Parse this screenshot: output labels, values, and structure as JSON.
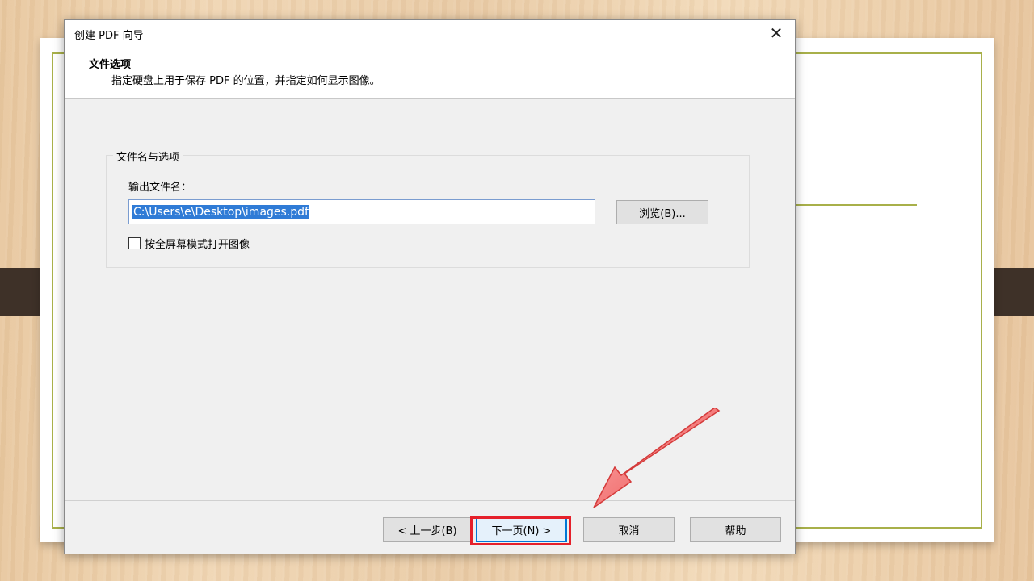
{
  "window": {
    "title": "创建 PDF 向导",
    "close_glyph": "✕"
  },
  "header": {
    "title": "文件选项",
    "subtitle": "指定硬盘上用于保存 PDF 的位置，并指定如何显示图像。"
  },
  "file_group": {
    "legend": "文件名与选项",
    "output_label": "输出文件名：",
    "output_path": "C:\\Users\\e\\Desktop\\images.pdf",
    "browse_label": "浏览(B)...",
    "fullscreen_label": "按全屏幕模式打开图像",
    "fullscreen_checked": false
  },
  "buttons": {
    "back": "< 上一步(B)",
    "next": "下一页(N) >",
    "cancel": "取消",
    "help": "帮助"
  },
  "colors": {
    "highlight": "#e5202a",
    "arrow": "#f06a6a",
    "selection": "#2f7bd6",
    "slide_border": "#a8b04a"
  },
  "icons": {
    "close": "close-icon",
    "checkbox": "checkbox-icon",
    "annotation_arrow": "arrow-icon"
  }
}
